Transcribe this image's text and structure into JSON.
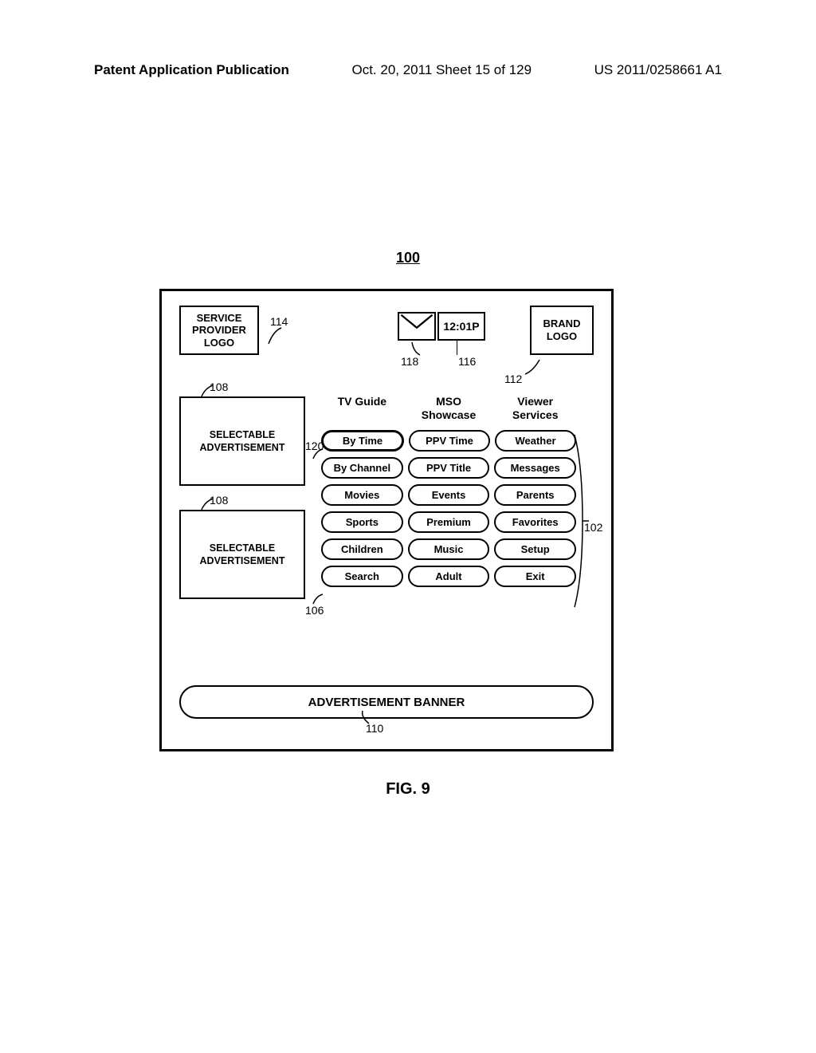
{
  "header": {
    "left": "Patent Application Publication",
    "mid": "Oct. 20, 2011  Sheet 15 of 129",
    "right": "US 2011/0258661 A1"
  },
  "figure": {
    "top_ref": "100",
    "caption": "FIG. 9"
  },
  "top": {
    "service_provider_logo": "SERVICE PROVIDER LOGO",
    "clock": "12:01P",
    "brand_logo": "BRAND LOGO"
  },
  "ads": {
    "ad1": "SELECTABLE ADVERTISEMENT",
    "ad2": "SELECTABLE ADVERTISEMENT"
  },
  "menu": {
    "headers": [
      "TV Guide",
      "MSO Showcase",
      "Viewer Services"
    ],
    "rows": [
      [
        "By Time",
        "PPV Time",
        "Weather"
      ],
      [
        "By Channel",
        "PPV Title",
        "Messages"
      ],
      [
        "Movies",
        "Events",
        "Parents"
      ],
      [
        "Sports",
        "Premium",
        "Favorites"
      ],
      [
        "Children",
        "Music",
        "Setup"
      ],
      [
        "Search",
        "Adult",
        "Exit"
      ]
    ],
    "selected": "By Time"
  },
  "banner": "ADVERTISEMENT BANNER",
  "refs": {
    "r114": "114",
    "r118": "118",
    "r116": "116",
    "r112": "112",
    "r108a": "108",
    "r108b": "108",
    "r120": "120",
    "r106": "106",
    "r102": "102",
    "r110": "110"
  }
}
